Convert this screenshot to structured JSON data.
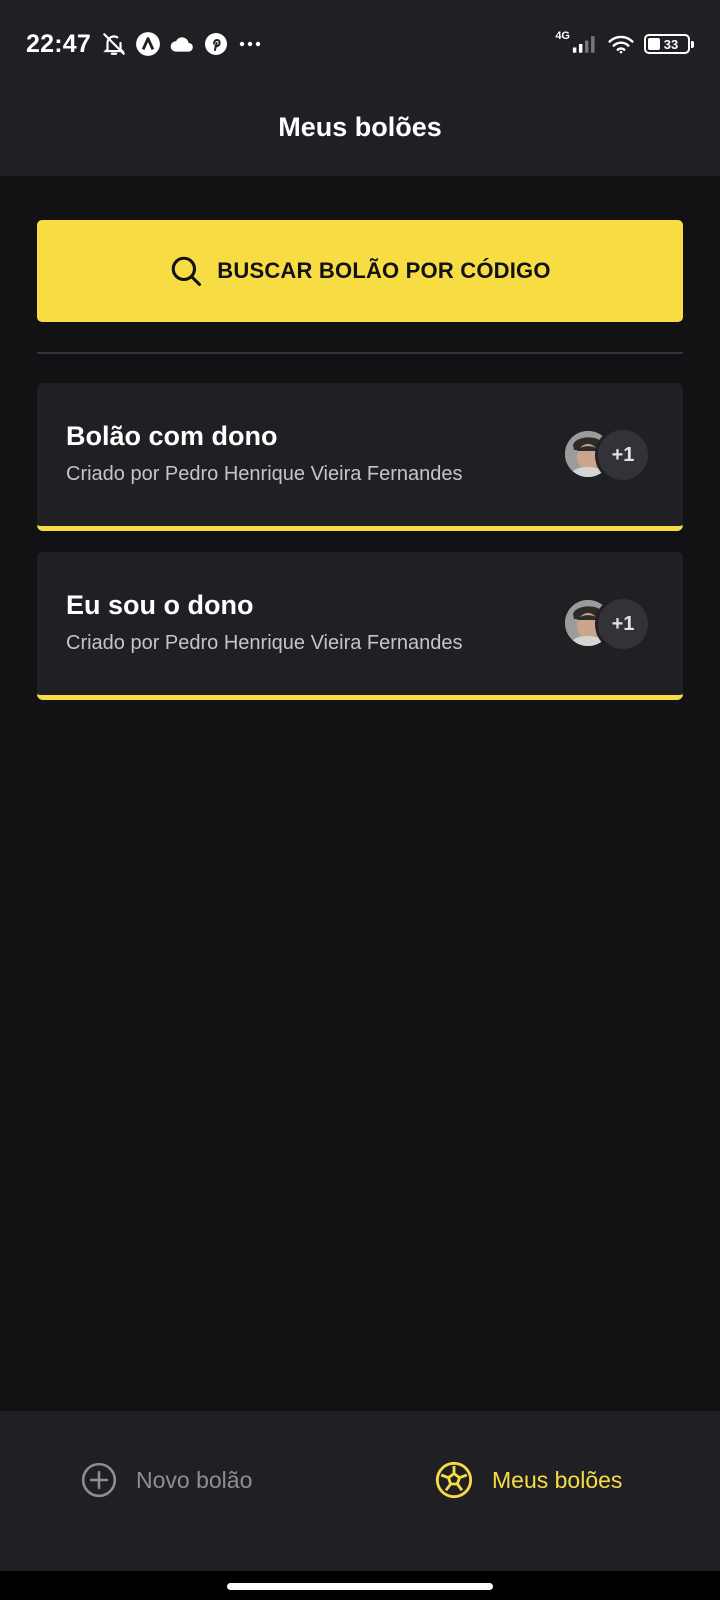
{
  "status_bar": {
    "time": "22:47",
    "network": "4G",
    "battery": "33",
    "left_icons": [
      "bell-off-icon",
      "app-a-icon",
      "cloud-icon",
      "pinterest-icon",
      "more-dots-icon"
    ],
    "right_icons": [
      "signal-icon",
      "wifi-icon",
      "battery-icon"
    ]
  },
  "header": {
    "title": "Meus bolões"
  },
  "search_button": {
    "label": "BUSCAR BOLÃO POR CÓDIGO",
    "icon": "search-icon"
  },
  "pools": [
    {
      "title": "Bolão com dono",
      "subtitle": "Criado por Pedro Henrique Vieira Fernandes",
      "extra_participants": "+1"
    },
    {
      "title": "Eu sou o dono",
      "subtitle": "Criado por Pedro Henrique Vieira Fernandes",
      "extra_participants": "+1"
    }
  ],
  "tabs": {
    "new_pool": {
      "label": "Novo bolão",
      "icon": "plus-circle-icon"
    },
    "my_pools": {
      "label": "Meus bolões",
      "icon": "soccer-ball-icon",
      "active": true
    }
  },
  "colors": {
    "accent": "#F7DD43",
    "background": "#121214",
    "surface": "#202024",
    "muted_text": "#8D8D99",
    "subtitle_text": "#C4C4CC"
  }
}
